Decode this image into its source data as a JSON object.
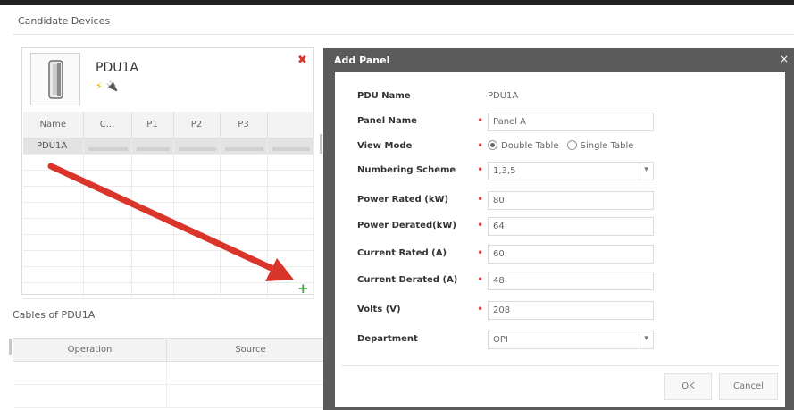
{
  "page": {
    "section_title": "Candidate Devices"
  },
  "device": {
    "name": "PDU1A",
    "icon": "rack-pdu-icon",
    "close_glyph": "✖",
    "grid_headers": [
      "Name",
      "C...",
      "P1",
      "P2",
      "P3"
    ],
    "grid_rows": [
      {
        "name": "PDU1A"
      }
    ],
    "add_glyph": "+"
  },
  "cables": {
    "title": "Cables of PDU1A",
    "headers": [
      "Operation",
      "Source"
    ]
  },
  "dialog": {
    "title": "Add Panel",
    "close_glyph": "×",
    "pdu_name": {
      "label": "PDU Name",
      "value": "PDU1A"
    },
    "panel_name": {
      "label": "Panel Name",
      "value": "Panel A"
    },
    "view_mode": {
      "label": "View Mode",
      "options": [
        "Double Table",
        "Single Table"
      ],
      "selected": "Double Table"
    },
    "numbering_scheme": {
      "label": "Numbering Scheme",
      "value": "1,3,5"
    },
    "power_rated": {
      "label": "Power Rated (kW)",
      "value": "80"
    },
    "power_derated": {
      "label": "Power Derated(kW)",
      "value": "64"
    },
    "current_rated": {
      "label": "Current Rated (A)",
      "value": "60"
    },
    "current_derated": {
      "label": "Current Derated (A)",
      "value": "48"
    },
    "volts": {
      "label": "Volts (V)",
      "value": "208"
    },
    "department": {
      "label": "Department",
      "value": "OPI"
    },
    "required_mark": "•",
    "ok_label": "OK",
    "cancel_label": "Cancel"
  },
  "colors": {
    "modal_header": "#5b5b5b",
    "required": "#e3484a",
    "annotation_arrow": "#d9352b",
    "add_button": "#3ea63e"
  }
}
